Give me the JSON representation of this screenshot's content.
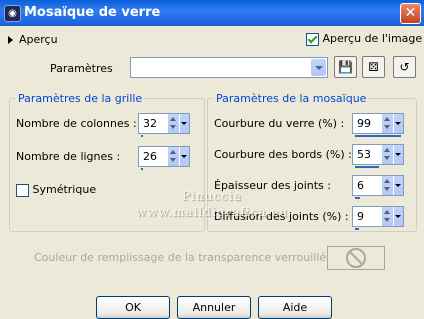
{
  "window": {
    "title": "Mosaïque de verre",
    "close_glyph": "✕"
  },
  "top": {
    "preview_toggle_label": "Aperçu",
    "preview_image_label": "Aperçu de l'image",
    "preview_image_checked": true
  },
  "parametres": {
    "label": "Paramètres",
    "selected_value": ""
  },
  "grille": {
    "title": "Paramètres de la grille",
    "colonnes": {
      "label": "Nombre de colonnes :",
      "value": "32",
      "fill_fraction": 0.05
    },
    "lignes": {
      "label": "Nombre de lignes :",
      "value": "26",
      "fill_fraction": 0.05
    },
    "symetrique": {
      "label": "Symétrique",
      "checked": false
    }
  },
  "mosaique": {
    "title": "Paramètres de la mosaïque",
    "courbure_verre": {
      "label": "Courbure du verre (%) :",
      "value": "99",
      "fill_fraction": 0.99
    },
    "courbure_bords": {
      "label": "Courbure des bords (%) :",
      "value": "53",
      "fill_fraction": 0.53
    },
    "epaisseur_joints": {
      "label": "Épaisseur des joints :",
      "value": "6",
      "fill_fraction": 0.1
    },
    "diffusion_joints": {
      "label": "Diffusion des joints (%) :",
      "value": "9",
      "fill_fraction": 0.09
    }
  },
  "watermark": {
    "line1": "Pinuccia",
    "line2": "www.maildigrafica.eu"
  },
  "remplissage": {
    "label": "Couleur de remplissage de la transparence verrouillée :"
  },
  "buttons": {
    "ok": "OK",
    "annuler": "Annuler",
    "aide": "Aide"
  },
  "colors": {
    "accent": "#0046d5",
    "title_bar": "#2f7cf0",
    "dialog_bg": "#ece9d8"
  }
}
